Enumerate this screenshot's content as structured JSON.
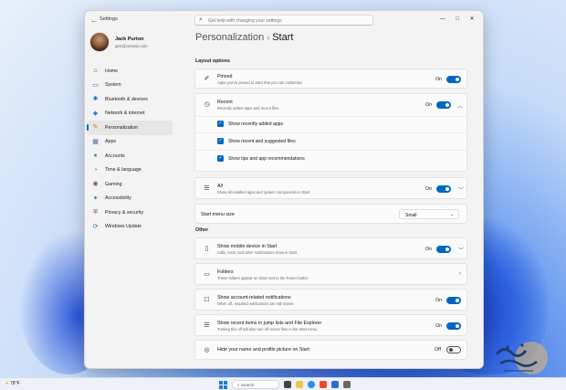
{
  "window": {
    "app_title": "Settings",
    "search_placeholder": "Get help with changing your settings",
    "controls": {
      "minimize": "—",
      "maximize": "□",
      "close": "✕"
    }
  },
  "profile": {
    "name": "Jack Purton",
    "email": "jack@contoso.com"
  },
  "sidebar": {
    "items": [
      {
        "label": "Home",
        "icon": "home-icon",
        "glyph": "⌂",
        "color": "#444444"
      },
      {
        "label": "System",
        "icon": "system-icon",
        "glyph": "▭",
        "color": "#1a73d6"
      },
      {
        "label": "Bluetooth & devices",
        "icon": "bluetooth-icon",
        "glyph": "✱",
        "color": "#1a73d6"
      },
      {
        "label": "Network & internet",
        "icon": "wifi-icon",
        "glyph": "◆",
        "color": "#3a7bd5"
      },
      {
        "label": "Personalization",
        "icon": "brush-icon",
        "glyph": "✎",
        "color": "#d4772c"
      },
      {
        "label": "Apps",
        "icon": "apps-icon",
        "glyph": "▦",
        "color": "#4a6fa5"
      },
      {
        "label": "Accounts",
        "icon": "accounts-icon",
        "glyph": "●",
        "color": "#2aa44f"
      },
      {
        "label": "Time & language",
        "icon": "clock-globe-icon",
        "glyph": "◔",
        "color": "#1a73d6"
      },
      {
        "label": "Gaming",
        "icon": "gamepad-icon",
        "glyph": "◉",
        "color": "#666666"
      },
      {
        "label": "Accessibility",
        "icon": "accessibility-icon",
        "glyph": "✦",
        "color": "#1a73d6"
      },
      {
        "label": "Privacy & security",
        "icon": "shield-icon",
        "glyph": "⛨",
        "color": "#666666"
      },
      {
        "label": "Windows Update",
        "icon": "update-icon",
        "glyph": "⟳",
        "color": "#1a73d6"
      }
    ],
    "active_index": 4
  },
  "breadcrumb": {
    "parent": "Personalization",
    "separator": "›",
    "current": "Start"
  },
  "layout_options": {
    "section_title": "Layout options",
    "pinned": {
      "title": "Pinned",
      "desc": "Apps you've pinned to Start that you can customize",
      "state": "On"
    },
    "recent": {
      "title": "Recent",
      "desc": "Recently added apps and recent files",
      "state": "On",
      "options": [
        {
          "label": "Show recently added apps",
          "checked": true
        },
        {
          "label": "Show recent and suggested files",
          "checked": true
        },
        {
          "label": "Show tips and app recommendations",
          "checked": true
        }
      ]
    },
    "all": {
      "title": "All",
      "desc": "Show all installed apps and system components in Start",
      "state": "On"
    },
    "menu_size": {
      "title": "Start menu size",
      "value": "Small"
    }
  },
  "other": {
    "section_title": "Other",
    "mobile": {
      "title": "Show mobile device in Start",
      "desc": "Calls, texts, and other notifications show in Start",
      "state": "On"
    },
    "folders": {
      "title": "Folders",
      "desc": "These folders appear on Start next to the Power button"
    },
    "account": {
      "title": "Show account-related notifications",
      "desc": "When off, required notifications are still shown",
      "state": "On"
    },
    "jumplists": {
      "title": "Show recent items in jump lists and File Explorer",
      "desc": "Turning this off will also turn off recent files in the Start menu",
      "state": "On"
    },
    "profile_pic": {
      "title": "Hide your name and profile picture on Start",
      "state": "Off"
    }
  },
  "taskbar": {
    "weather": "78°F",
    "search_label": "Search"
  },
  "colors": {
    "accent": "#0067c0"
  }
}
